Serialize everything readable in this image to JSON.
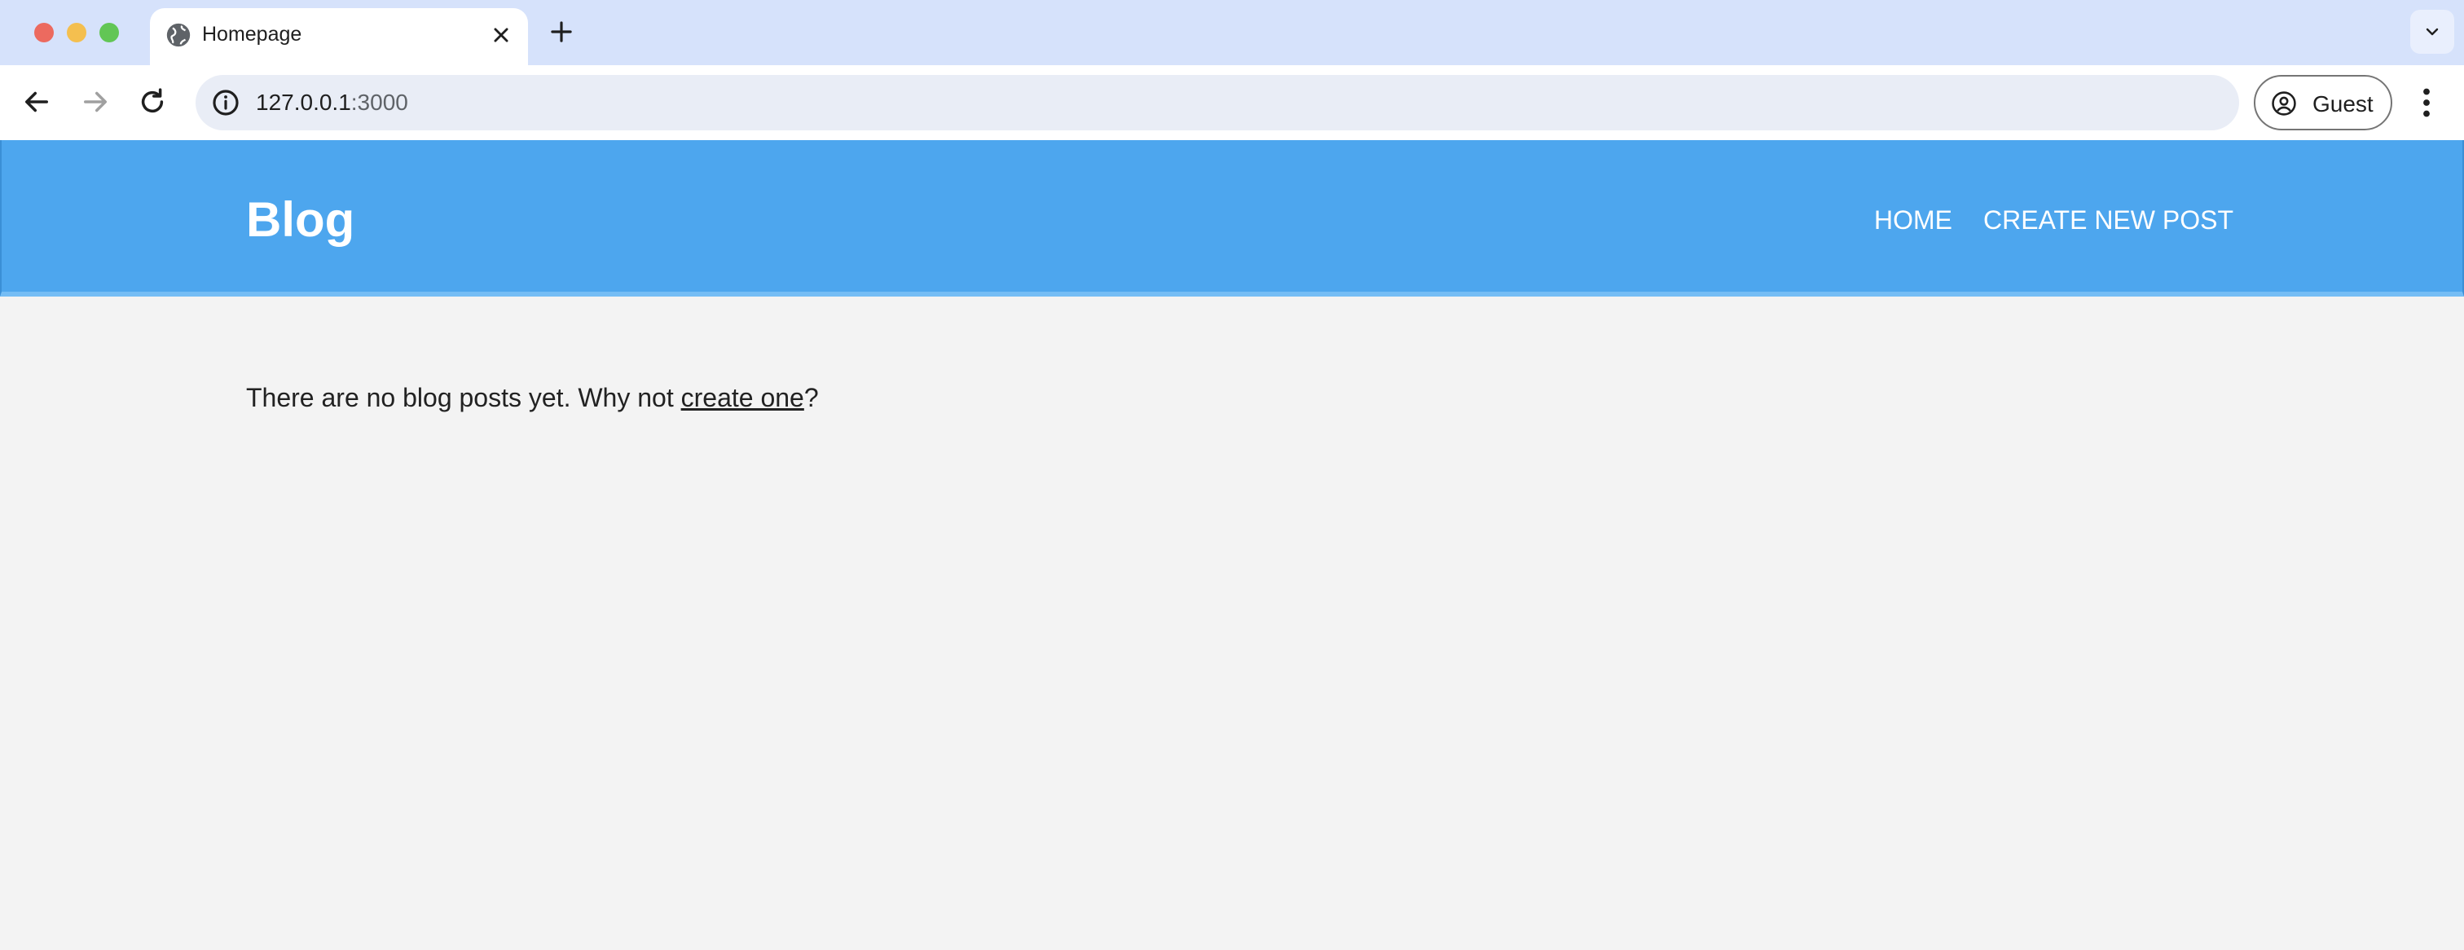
{
  "browser": {
    "tab": {
      "title": "Homepage",
      "favicon": "globe-icon"
    },
    "address": {
      "host": "127.0.0.1",
      "port": ":3000"
    },
    "profile_label": "Guest",
    "colors": {
      "tabstrip": "#d6e2fb",
      "omnibox": "#e9edf6"
    }
  },
  "site": {
    "brand": "Blog",
    "nav": {
      "home": "HOME",
      "create": "CREATE NEW POST"
    },
    "empty_message": {
      "before": "There are no blog posts yet. Why not ",
      "link": "create one",
      "after": "?"
    },
    "colors": {
      "header": "#4da6ee",
      "background": "#f3f3f3"
    }
  }
}
